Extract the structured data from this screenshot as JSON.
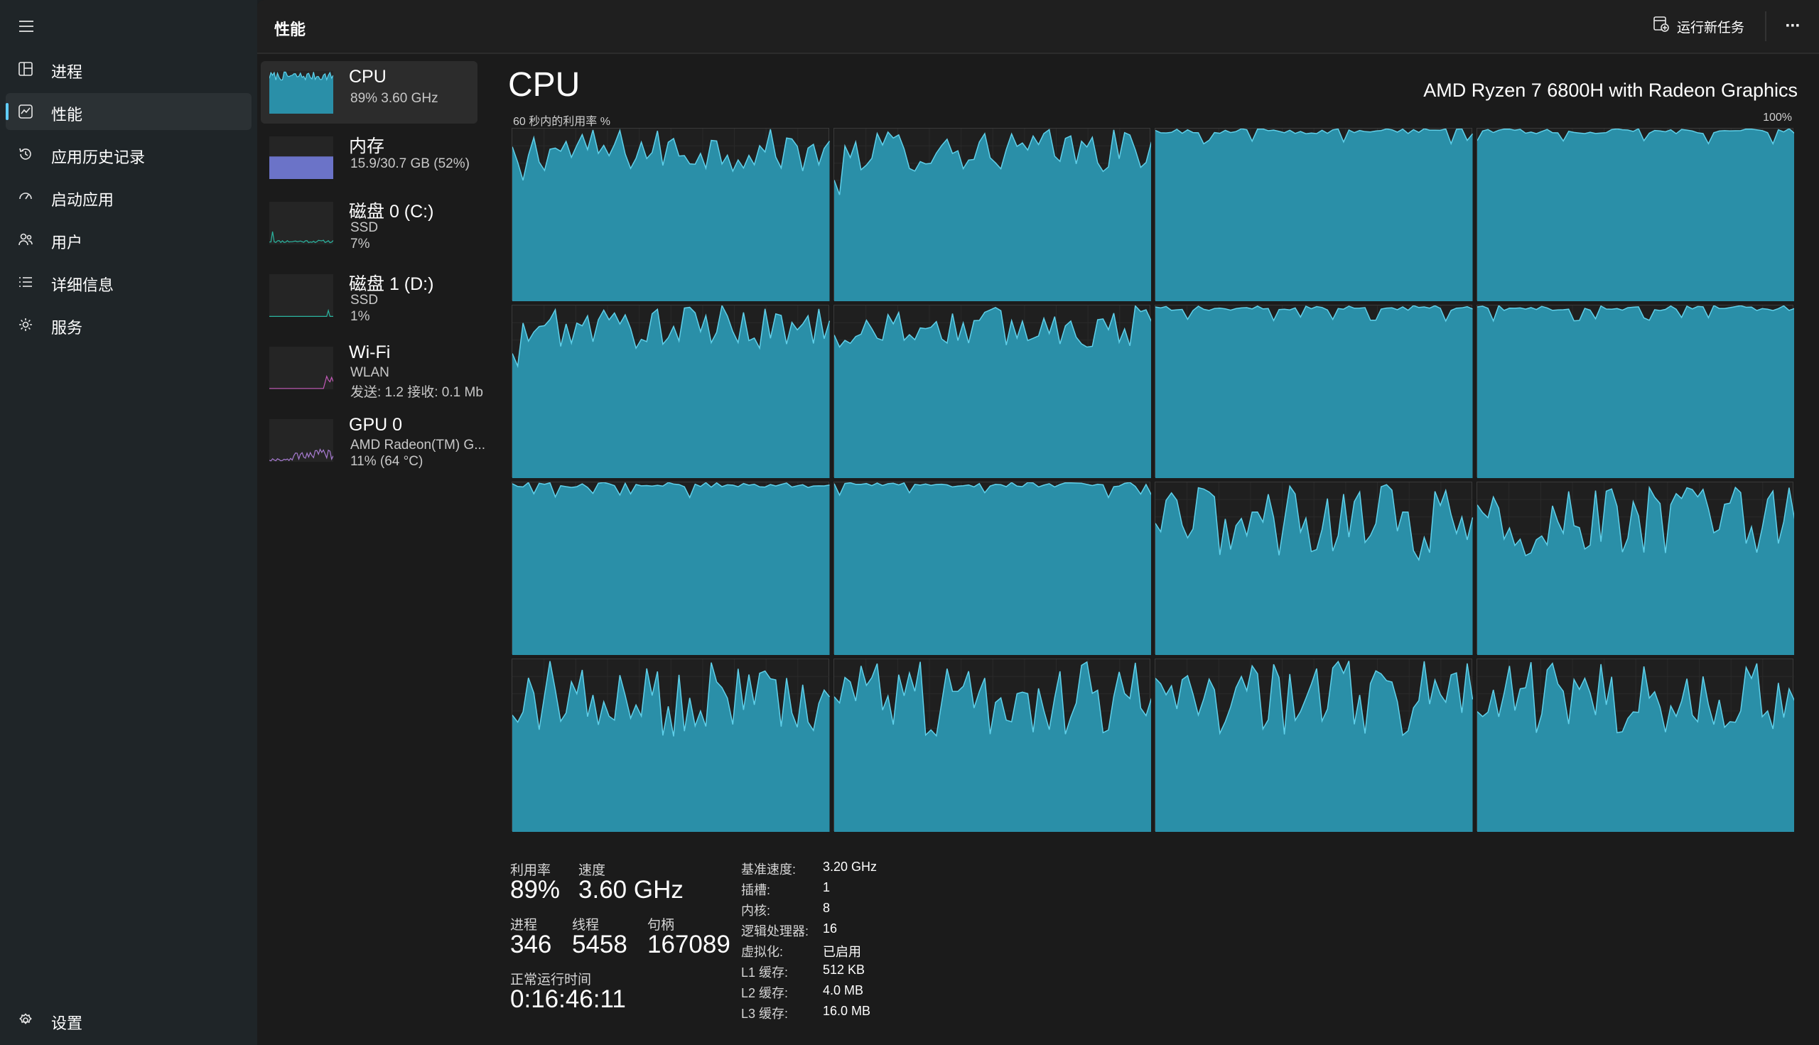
{
  "colors": {
    "accent": "#60cdff",
    "cpu_fill": "#2a8fa8",
    "cpu_line": "#5fd0ea",
    "memory_fill": "#6b73c8",
    "disk_line": "#2bb5a0",
    "wifi_line": "#c45ab8",
    "gpu_line": "#a77bd1"
  },
  "nav": {
    "menu_icon": "hamburger-icon",
    "items": [
      {
        "label": "进程",
        "icon": "processes-icon"
      },
      {
        "label": "性能",
        "icon": "performance-icon"
      },
      {
        "label": "应用历史记录",
        "icon": "history-icon"
      },
      {
        "label": "启动应用",
        "icon": "startup-icon"
      },
      {
        "label": "用户",
        "icon": "users-icon"
      },
      {
        "label": "详细信息",
        "icon": "details-icon"
      },
      {
        "label": "服务",
        "icon": "services-icon"
      }
    ],
    "settings_label": "设置"
  },
  "header": {
    "title": "性能",
    "run_task_label": "运行新任务",
    "more_label": "···"
  },
  "resources": [
    {
      "name": "CPU",
      "sub1": "89%  3.60 GHz",
      "sub2": ""
    },
    {
      "name": "内存",
      "sub1": "15.9/30.7 GB (52%)",
      "sub2": ""
    },
    {
      "name": "磁盘 0 (C:)",
      "sub1": "SSD",
      "sub2": "7%"
    },
    {
      "name": "磁盘 1 (D:)",
      "sub1": "SSD",
      "sub2": "1%"
    },
    {
      "name": "Wi-Fi",
      "sub1": "WLAN",
      "sub2": "发送: 1.2  接收: 0.1 Mb"
    },
    {
      "name": "GPU 0",
      "sub1": "AMD Radeon(TM) G...",
      "sub2": "11% (64 °C)"
    }
  ],
  "cpu": {
    "title": "CPU",
    "model": "AMD Ryzen 7 6800H with Radeon Graphics",
    "graph_label": "60 秒内的利用率 %",
    "graph_max": "100%",
    "core_count": 16
  },
  "stats": {
    "utilization_label": "利用率",
    "utilization": "89%",
    "speed_label": "速度",
    "speed": "3.60 GHz",
    "processes_label": "进程",
    "processes": "346",
    "threads_label": "线程",
    "threads": "5458",
    "handles_label": "句柄",
    "handles": "167089",
    "uptime_label": "正常运行时间",
    "uptime": "0:16:46:11"
  },
  "specs": [
    {
      "key": "基准速度:",
      "value": "3.20 GHz"
    },
    {
      "key": "插槽:",
      "value": "1"
    },
    {
      "key": "内核:",
      "value": "8"
    },
    {
      "key": "逻辑处理器:",
      "value": "16"
    },
    {
      "key": "虚拟化:",
      "value": "已启用"
    },
    {
      "key": "L1 缓存:",
      "value": "512 KB"
    },
    {
      "key": "L2 缓存:",
      "value": "4.0 MB"
    },
    {
      "key": "L3 缓存:",
      "value": "16.0 MB"
    }
  ]
}
